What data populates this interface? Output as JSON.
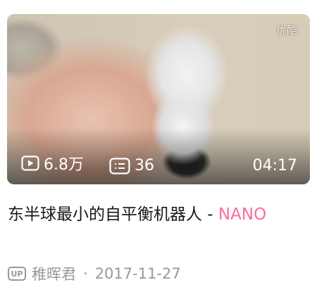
{
  "video": {
    "watermark": "优酷",
    "views": "6.8万",
    "danmaku": "36",
    "duration": "04:17",
    "title_main": "东半球最小的自平衡机器人 - ",
    "title_highlight": "NANO",
    "up_badge": "UP",
    "author": "稚晖君",
    "separator": "·",
    "date": "2017-11-27"
  },
  "colors": {
    "highlight": "#fb6d9a",
    "meta": "#9499a0",
    "title": "#18191c"
  },
  "icons": [
    "play-icon",
    "danmaku-icon",
    "up-badge-icon"
  ]
}
